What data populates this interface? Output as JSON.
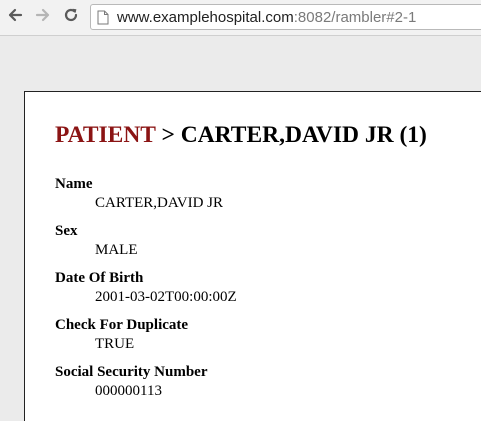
{
  "browser": {
    "url_host": "www.examplehospital.com",
    "url_rest": ":8082/rambler#2-1",
    "icons": {
      "back": "back-arrow-icon",
      "forward": "forward-arrow-icon",
      "reload": "reload-icon",
      "page": "page-icon"
    }
  },
  "record": {
    "type": "PATIENT",
    "separator": " > ",
    "name": "CARTER,DAVID JR (1)",
    "type_color": "#8b1414"
  },
  "fields": [
    {
      "label": "Name",
      "value": "CARTER,DAVID JR"
    },
    {
      "label": "Sex",
      "value": "MALE"
    },
    {
      "label": "Date Of Birth",
      "value": "2001-03-02T00:00:00Z"
    },
    {
      "label": "Check For Duplicate",
      "value": "TRUE"
    },
    {
      "label": "Social Security Number",
      "value": "000000113"
    }
  ]
}
